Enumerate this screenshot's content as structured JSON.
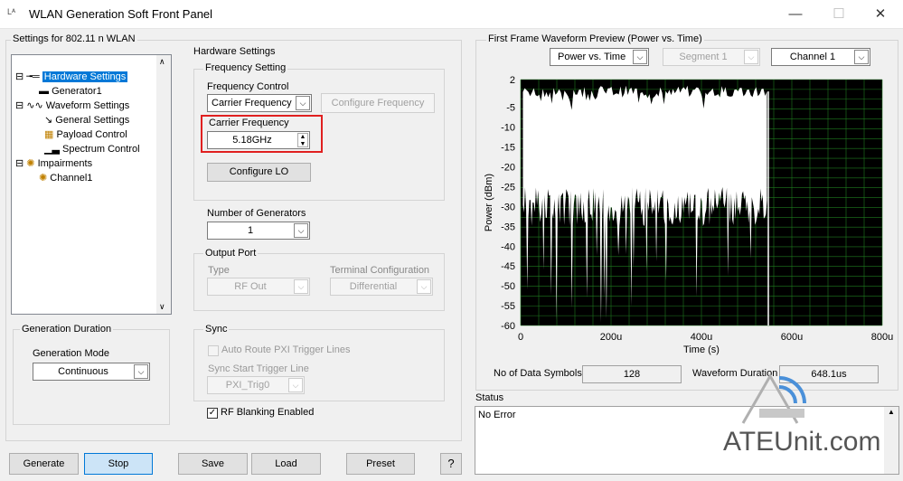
{
  "window": {
    "title": "WLAN Generation Soft Front Panel",
    "minimize": "—",
    "maximize": "☐",
    "close": "✕"
  },
  "settings_title": "Settings for 802.11 n WLAN",
  "tree": {
    "hardware_settings": "Hardware Settings",
    "generator1": "Generator1",
    "waveform_settings": "Waveform Settings",
    "general_settings": "General Settings",
    "payload_control": "Payload Control",
    "spectrum_control": "Spectrum Control",
    "impairments": "Impairments",
    "channel1": "Channel1"
  },
  "generation_duration": {
    "group_label": "Generation Duration",
    "mode_label": "Generation Mode",
    "mode_value": "Continuous"
  },
  "hardware": {
    "group_label": "Hardware Settings",
    "freq_group_label": "Frequency Setting",
    "freq_control_label": "Frequency Control",
    "freq_control_value": "Carrier Frequency",
    "configure_frequency": "Configure Frequency",
    "carrier_freq_label": "Carrier Frequency",
    "carrier_freq_value": "5.18GHz",
    "configure_lo": "Configure LO",
    "num_generators_label": "Number of Generators",
    "num_generators_value": "1",
    "output_port_label": "Output Port",
    "type_label": "Type",
    "type_value": "RF Out",
    "terminal_label": "Terminal Configuration",
    "terminal_value": "Differential",
    "sync_label": "Sync",
    "auto_route_label": "Auto Route PXI Trigger Lines",
    "sync_start_label": "Sync Start Trigger Line",
    "sync_start_value": "PXI_Trig0",
    "rf_blanking_label": "RF Blanking Enabled"
  },
  "preview": {
    "group_label": "First Frame Waveform Preview (Power vs. Time)",
    "view_value": "Power vs. Time",
    "segment_value": "Segment 1",
    "channel_value": "Channel 1",
    "data_symbols_label": "No of Data Symbols",
    "data_symbols_value": "128",
    "waveform_duration_label": "Waveform Duration",
    "waveform_duration_value": "648.1us"
  },
  "status": {
    "label": "Status",
    "value": "No Error"
  },
  "buttons": {
    "generate": "Generate",
    "stop": "Stop",
    "save": "Save",
    "load": "Load",
    "preset": "Preset",
    "help": "?"
  },
  "watermark": "ATEUnit.com",
  "chart_data": {
    "type": "area",
    "xlabel": "Time (s)",
    "ylabel": "Power (dBm)",
    "xlim": [
      0,
      0.0008
    ],
    "ylim": [
      -60,
      2
    ],
    "x_ticks": [
      "0",
      "200u",
      "400u",
      "600u",
      "800u"
    ],
    "y_ticks": [
      "2",
      "-5",
      "-10",
      "-15",
      "-20",
      "-25",
      "-30",
      "-35",
      "-40",
      "-45",
      "-50",
      "-55",
      "-60"
    ],
    "grid": true,
    "background": "#000000",
    "grid_color": "#1f7a1f",
    "series": [
      {
        "color": "#ffffff",
        "x": [
          5e-06,
          0.000545
        ],
        "upper": -1,
        "lower_min": -60,
        "lower_typical": -30
      }
    ],
    "signal_end": 0.000548
  },
  "colors": {
    "highlight_box": "#e02020",
    "selection": "#0078d7",
    "accent_button": "#cce4f7"
  }
}
